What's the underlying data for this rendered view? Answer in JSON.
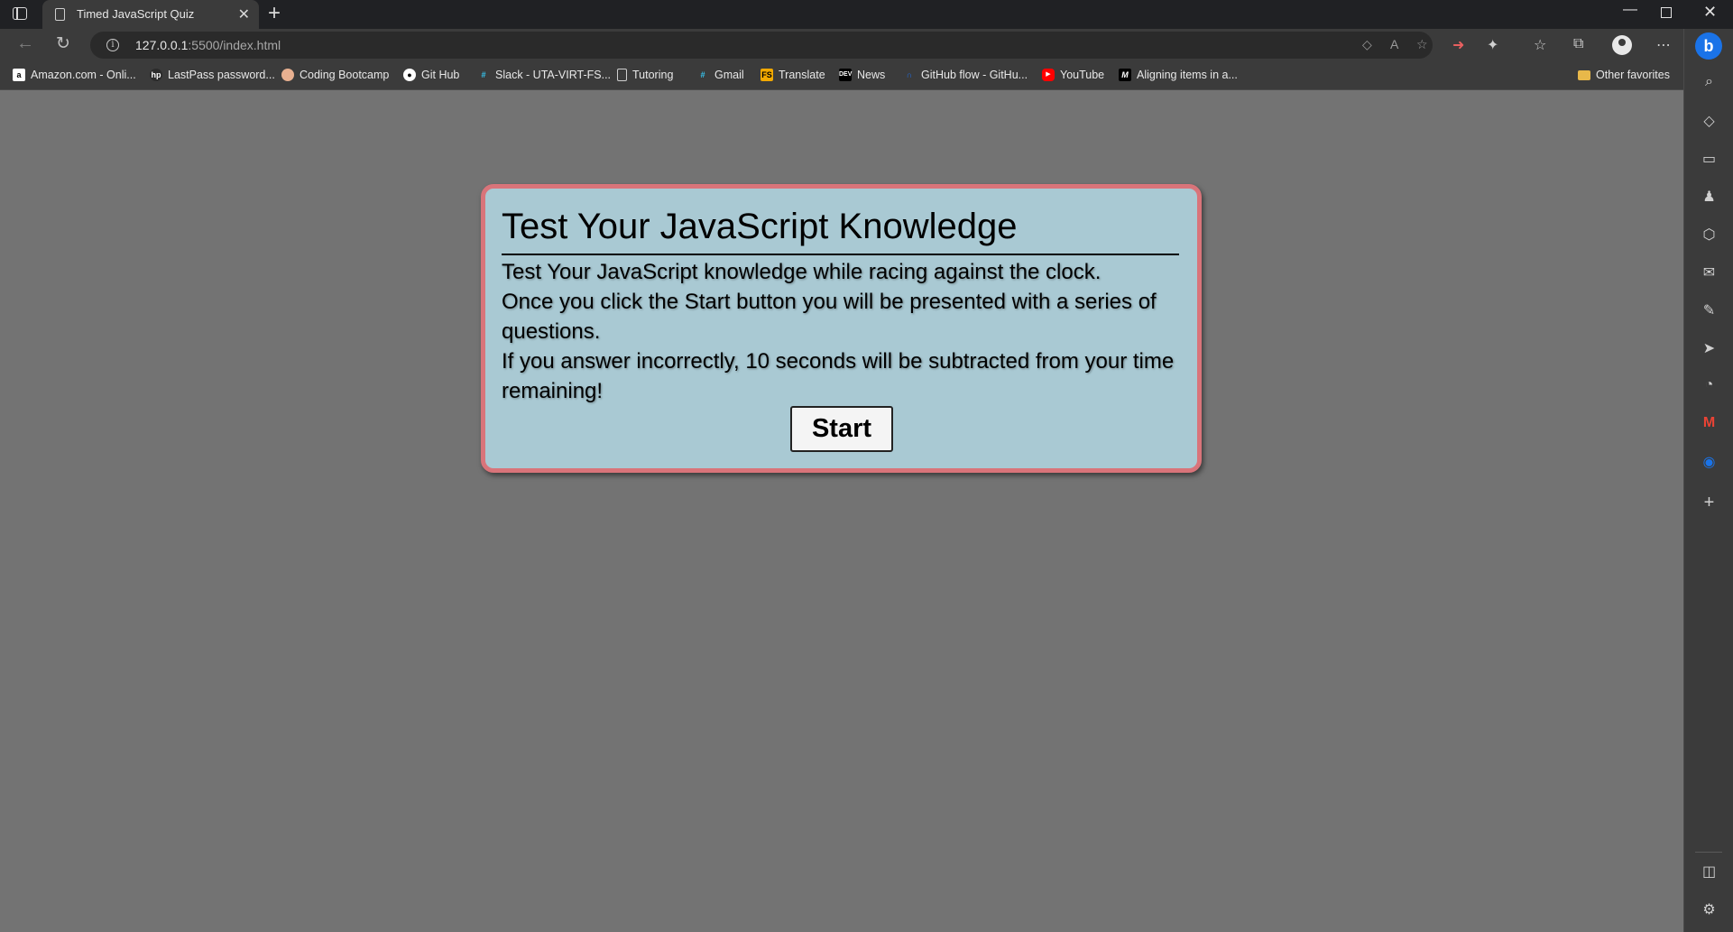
{
  "browser": {
    "tab_title": "Timed JavaScript Quiz",
    "tab_close": "✕",
    "new_tab": "+",
    "url_host": "127.0.0.1",
    "url_rest": ":5500/index.html",
    "window_controls": {
      "minimize": "—",
      "close": "✕"
    }
  },
  "bookmarks": [
    {
      "label": "Amazon.com - Onli...",
      "icon": "amazon-icon",
      "color": "#ffffff"
    },
    {
      "label": "LastPass password...",
      "icon": "hp-icon",
      "color": "#2b2b2b"
    },
    {
      "label": "Coding Bootcamp",
      "icon": "bootcamp-icon",
      "color": "#e8b090"
    },
    {
      "label": "Git Hub",
      "icon": "github-icon",
      "color": "#ffffff"
    },
    {
      "label": "Slack - UTA-VIRT-FS...",
      "icon": "slack-icon",
      "color": "#36c5f0"
    },
    {
      "label": "Tutoring",
      "icon": "document-icon",
      "color": "#cfcfcf"
    },
    {
      "label": "Gmail",
      "icon": "slack-icon",
      "color": "#36c5f0"
    },
    {
      "label": "Translate",
      "icon": "translate-icon",
      "color": "#f2a900"
    },
    {
      "label": "News",
      "icon": "dev-icon",
      "color": "#000000"
    },
    {
      "label": "GitHub flow - GitHu...",
      "icon": "github-docs-icon",
      "color": "#1f6feb"
    },
    {
      "label": "YouTube",
      "icon": "youtube-icon",
      "color": "#ff0000"
    },
    {
      "label": "Aligning items in a...",
      "icon": "mdn-icon",
      "color": "#000000"
    }
  ],
  "other_favorites": "Other favorites",
  "colors": {
    "page_background": "#737373",
    "card_background": "#a9c9d3",
    "card_border": "#d9747a",
    "browser_chrome": "#3b3b3b"
  },
  "quiz": {
    "title": "Test Your JavaScript Knowledge",
    "line1": "Test Your JavaScript knowledge while racing against the clock.",
    "line2": "Once you click the Start button you will be presented with a series of questions.",
    "line3": "If you answer incorrectly, 10 seconds will be subtracted from your time remaining!",
    "start_label": "Start"
  }
}
